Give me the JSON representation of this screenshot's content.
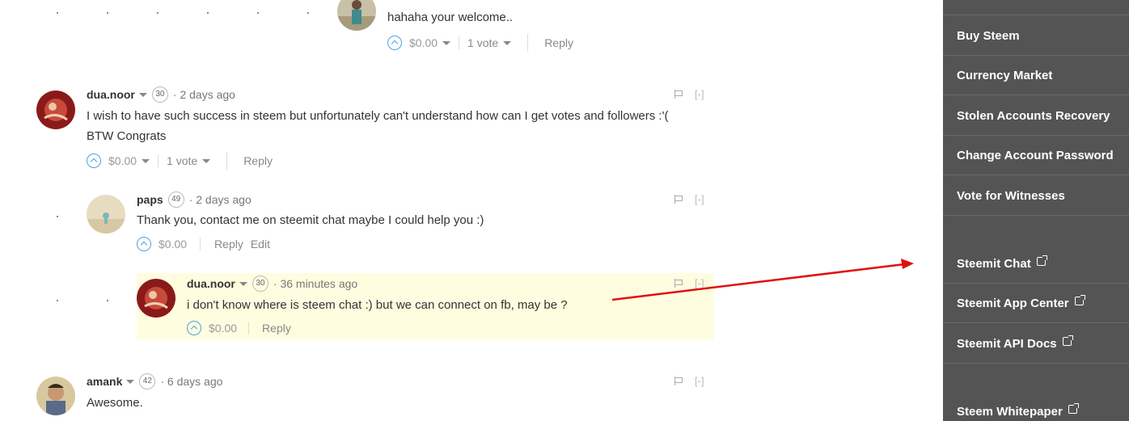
{
  "comments": [
    {
      "author": "",
      "reputation": "",
      "time": "",
      "body": [
        "hahaha your welcome.."
      ],
      "payout": "$0.00",
      "votes": "1 vote",
      "reply": "Reply"
    },
    {
      "author": "dua.noor",
      "reputation": "30",
      "time": "· 2 days ago",
      "body": [
        "I wish to have such success in steem but unfortunately can't understand how can I get votes and followers :'(",
        "BTW Congrats"
      ],
      "payout": "$0.00",
      "votes": "1 vote",
      "reply": "Reply",
      "hide": "[-]"
    },
    {
      "author": "paps",
      "reputation": "49",
      "time": "· 2 days ago",
      "body": [
        "Thank you, contact me on steemit chat maybe I could help you :)"
      ],
      "payout": "$0.00",
      "reply": "Reply",
      "edit": "Edit",
      "hide": "[-]"
    },
    {
      "author": "dua.noor",
      "reputation": "30",
      "time": "· 36 minutes ago",
      "body": [
        "i don't know where is steem chat :) but we can connect on fb, may be ?"
      ],
      "payout": "$0.00",
      "reply": "Reply",
      "hide": "[-]"
    },
    {
      "author": "amank",
      "reputation": "42",
      "time": "· 6 days ago",
      "body": [
        "Awesome."
      ],
      "hide": "[-]"
    }
  ],
  "sidebar": {
    "items": [
      {
        "label": "Buy Steem"
      },
      {
        "label": "Currency Market"
      },
      {
        "label": "Stolen Accounts Recovery"
      },
      {
        "label": "Change Account Password"
      },
      {
        "label": "Vote for Witnesses"
      },
      {
        "label": "Steemit Chat"
      },
      {
        "label": "Steemit App Center"
      },
      {
        "label": "Steemit API Docs"
      },
      {
        "label": "Steem Whitepaper"
      }
    ]
  },
  "annotation": {
    "color": "#e01010"
  },
  "colors": {
    "sidebar_bg": "#545454",
    "highlight_bg": "#fffde0",
    "upvote": "#4aa3df"
  }
}
